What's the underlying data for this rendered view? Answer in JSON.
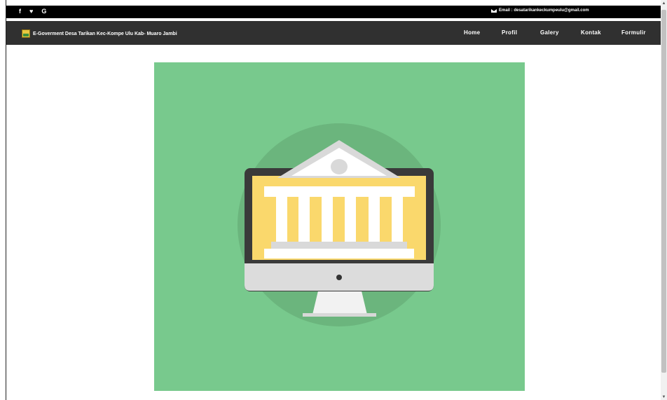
{
  "topbar": {
    "social": [
      {
        "icon": "facebook-icon",
        "glyph": "f"
      },
      {
        "icon": "twitter-icon",
        "glyph": "♥"
      },
      {
        "icon": "google-icon",
        "glyph": "G"
      }
    ],
    "email": "Email : desatarikankeckumpeulu@gmail.com"
  },
  "navbar": {
    "brand": "E-Goverment Desa Tarikan Kec-Kompe Ulu Kab- Muaro Jambi",
    "items": [
      "Home",
      "Profil",
      "Galery",
      "Kontak",
      "Formulir"
    ]
  },
  "hero": {
    "illustration": "government-building-on-monitor",
    "colors": {
      "background": "#78c98d",
      "circle": "#6bb57d",
      "monitor_frame": "#3a3a3a",
      "screen": "#fad86c",
      "building": "#ffffff",
      "stand": "#dcdcdc"
    }
  },
  "colors": {
    "topbar": "#000000",
    "navbar": "#303030"
  }
}
